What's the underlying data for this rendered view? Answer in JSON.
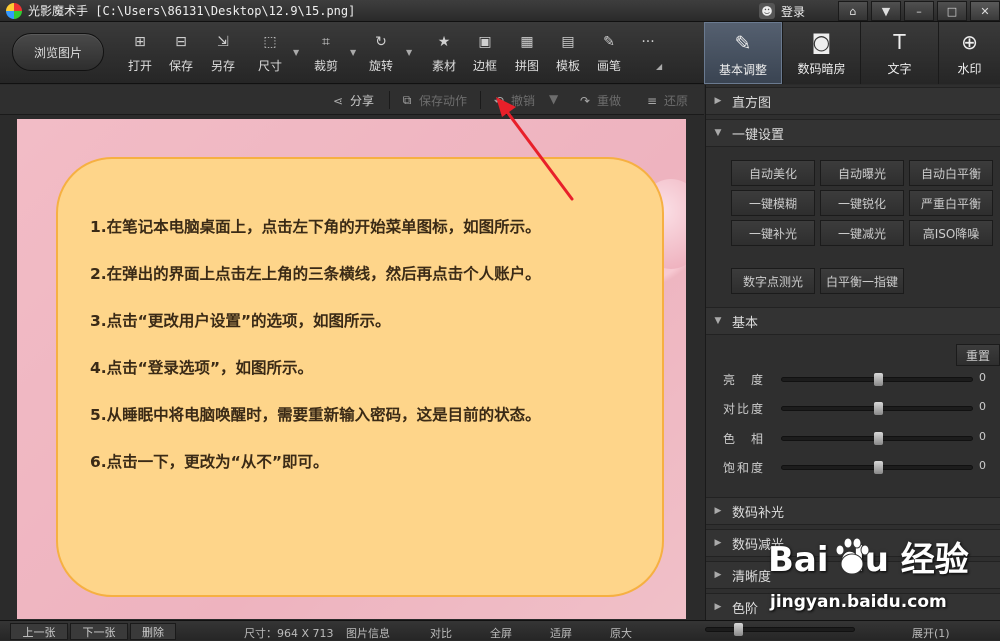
{
  "window": {
    "app_name": "光影魔术手",
    "file_path": "[C:\\Users\\86131\\Desktop\\12.9\\15.png]",
    "login_label": "登录",
    "window_buttons": [
      "⌂",
      "▼",
      "–",
      "□",
      "✕"
    ]
  },
  "toolbar": {
    "browse_label": "浏览图片",
    "tools": [
      {
        "label": "打开",
        "icon": "open-icon",
        "glyph": "⊞"
      },
      {
        "label": "保存",
        "icon": "save-icon",
        "glyph": "⊟"
      },
      {
        "label": "另存",
        "icon": "save-as-icon",
        "glyph": "⇲"
      },
      {
        "label": "尺寸",
        "icon": "resize-icon",
        "glyph": "⬚"
      },
      {
        "label": "裁剪",
        "icon": "crop-icon",
        "glyph": "⌗"
      },
      {
        "label": "旋转",
        "icon": "rotate-icon",
        "glyph": "↻"
      },
      {
        "label": "素材",
        "icon": "material-icon",
        "glyph": "★"
      },
      {
        "label": "边框",
        "icon": "frame-icon",
        "glyph": "▣"
      },
      {
        "label": "拼图",
        "icon": "collage-icon",
        "glyph": "▦"
      },
      {
        "label": "模板",
        "icon": "template-icon",
        "glyph": "▤"
      },
      {
        "label": "画笔",
        "icon": "brush-icon",
        "glyph": "✎"
      }
    ],
    "more_glyph": "···"
  },
  "mode_tabs": [
    {
      "label": "基本调整",
      "icon": "basic-adjust-icon",
      "glyph": "✎",
      "active": true
    },
    {
      "label": "数码暗房",
      "icon": "darkroom-icon",
      "glyph": "◙",
      "active": false
    },
    {
      "label": "文字",
      "icon": "text-icon",
      "glyph": "T",
      "active": false
    },
    {
      "label": "水印",
      "icon": "watermark-icon",
      "glyph": "⊕",
      "active": false
    }
  ],
  "subbar": {
    "share": "分享",
    "save_action": "保存动作",
    "undo": "撤销",
    "redo": "重做",
    "restore": "还原"
  },
  "image_content": {
    "steps": [
      "1.在笔记本电脑桌面上，点击左下角的开始菜单图标，如图所示。",
      "2.在弹出的界面上点击左上角的三条横线，然后再点击个人账户。",
      "3.点击“更改用户设置”的选项，如图所示。",
      "4.点击“登录选项”，如图所示。",
      "5.从睡眠中将电脑唤醒时，需要重新输入密码，这是目前的状态。",
      "6.点击一下，更改为“从不”即可。"
    ],
    "card_color": "#fed58a",
    "background_color": "#f2bcc6",
    "arrow_color": "#e8202a"
  },
  "panel": {
    "histogram": "直方图",
    "one_click_title": "一键设置",
    "one_click_buttons": [
      "自动美化",
      "自动曝光",
      "自动白平衡",
      "一键模糊",
      "一键锐化",
      "严重白平衡",
      "一键补光",
      "一键减光",
      "高ISO降噪"
    ],
    "extra_buttons": [
      "数字点测光",
      "白平衡一指键"
    ],
    "basic_title": "基本",
    "reset_label": "重置",
    "sliders": [
      {
        "label": "亮　度",
        "value": 0
      },
      {
        "label": "对比度",
        "value": 0
      },
      {
        "label": "色　相",
        "value": 0
      },
      {
        "label": "饱和度",
        "value": 0
      }
    ],
    "collapsed_sections": [
      "数码补光",
      "数码减光",
      "清晰度",
      "色阶"
    ]
  },
  "statusbar": {
    "prev": "上一张",
    "next": "下一张",
    "delete": "删除",
    "size": "尺寸：964 X 713",
    "info": "图片信息",
    "compare": "对比",
    "fullscreen": "全屏",
    "fit": "适屏",
    "original": "原大",
    "expand": "展开(1)"
  },
  "watermark": {
    "brand": "Bai du 经验",
    "url": "jingyan.baidu.com"
  }
}
